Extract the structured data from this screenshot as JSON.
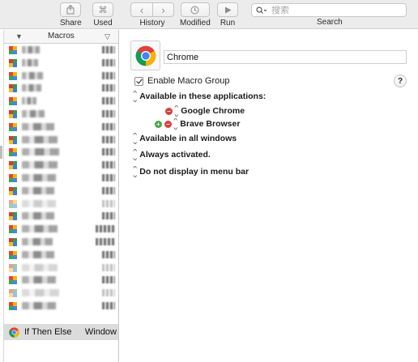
{
  "toolbar": {
    "share_label": "Share",
    "used_label": "Used",
    "history_label": "History",
    "modified_label": "Modified",
    "run_label": "Run",
    "search_label": "Search",
    "search_placeholder": "搜索",
    "share_icon": "share-icon",
    "used_icon": "command-icon",
    "history_back_icon": "chevron-left-icon",
    "history_forward_icon": "chevron-right-icon",
    "modified_icon": "clock-icon",
    "run_icon": "play-icon",
    "search_icon": "search-icon"
  },
  "sidebar": {
    "header_title": "Macros",
    "sort_glyph": "▼",
    "filter_glyph": "▽",
    "groups_note": "group names are pixelated/obscured in the screenshot",
    "selected_item": {
      "name": "If Then Else",
      "value": "Window"
    }
  },
  "main": {
    "group_name": "Chrome",
    "enable_label": "Enable Macro Group",
    "enabled": true,
    "help_glyph": "?",
    "available_apps_label": "Available in these applications:",
    "apps": [
      {
        "name": "Google Chrome",
        "has_add": false
      },
      {
        "name": "Brave Browser",
        "has_add": true
      }
    ],
    "windows_label": "Available in all windows",
    "activation_label": "Always activated.",
    "menu_bar_label": "Do not display in menu bar"
  },
  "colors": {
    "accent_red": "#d8413c",
    "accent_green": "#4aa54a",
    "selection_bg": "#dcdcdc",
    "toolbar_bg": "#ececec"
  }
}
